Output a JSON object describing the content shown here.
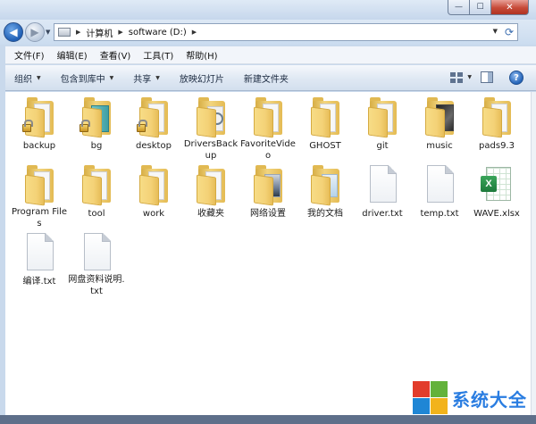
{
  "window": {
    "minimize_glyph": "—",
    "maximize_glyph": "☐",
    "close_glyph": "✕"
  },
  "nav": {
    "back_glyph": "◀",
    "forward_glyph": "▶",
    "history_glyph": "▼"
  },
  "address": {
    "segments": [
      "计算机",
      "software (D:)"
    ],
    "separator": "▶",
    "dropdown_glyph": "▼",
    "refresh_glyph": "⟳"
  },
  "menu": {
    "items": [
      "文件(F)",
      "编辑(E)",
      "查看(V)",
      "工具(T)",
      "帮助(H)"
    ]
  },
  "toolbar": {
    "organize": "组织",
    "include_in_library": "包含到库中",
    "share": "共享",
    "slideshow": "放映幻灯片",
    "new_folder": "新建文件夹",
    "help_glyph": "?",
    "dropdown_glyph": "▼"
  },
  "files": [
    {
      "name": "backup",
      "type": "folder",
      "overlay": "lock"
    },
    {
      "name": "bg",
      "type": "folder",
      "overlay": "lock-teal"
    },
    {
      "name": "desktop",
      "type": "folder",
      "overlay": "lock"
    },
    {
      "name": "DriversBackup",
      "type": "folder",
      "overlay": "gear"
    },
    {
      "name": "FavoriteVideo",
      "type": "folder",
      "overlay": "none"
    },
    {
      "name": "GHOST",
      "type": "folder",
      "overlay": "none"
    },
    {
      "name": "git",
      "type": "folder",
      "overlay": "none"
    },
    {
      "name": "music",
      "type": "folder",
      "overlay": "dark"
    },
    {
      "name": "pads9.3",
      "type": "folder",
      "overlay": "none"
    },
    {
      "name": "Program Files",
      "type": "folder",
      "overlay": "none"
    },
    {
      "name": "tool",
      "type": "folder",
      "overlay": "none"
    },
    {
      "name": "work",
      "type": "folder",
      "overlay": "none"
    },
    {
      "name": "收藏夹",
      "type": "folder",
      "overlay": "none"
    },
    {
      "name": "网络设置",
      "type": "folder",
      "overlay": "photo"
    },
    {
      "name": "我的文档",
      "type": "folder",
      "overlay": "doc"
    },
    {
      "name": "driver.txt",
      "type": "txt"
    },
    {
      "name": "temp.txt",
      "type": "txt"
    },
    {
      "name": "WAVE.xlsx",
      "type": "xlsx",
      "badge": "X"
    },
    {
      "name": "编译.txt",
      "type": "txt"
    },
    {
      "name": "网盘资料说明.txt",
      "type": "txt"
    }
  ],
  "watermark": {
    "text": "系统大全"
  },
  "colors": {
    "frame": "#c9d9ec",
    "folder": "#f2d57f",
    "excel_green": "#1d7a3b",
    "watermark_blue": "#2a7de1"
  }
}
